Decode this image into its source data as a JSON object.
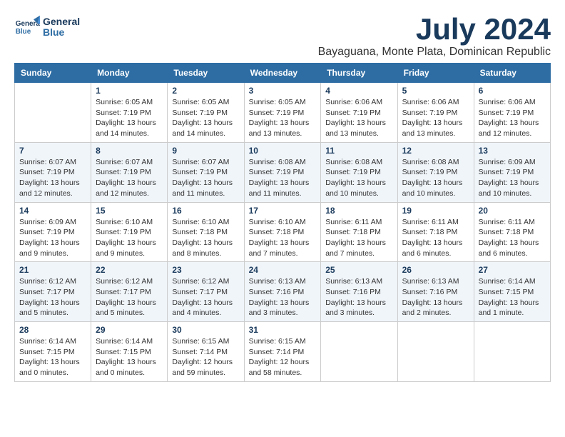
{
  "header": {
    "logo_line1": "General",
    "logo_line2": "Blue",
    "month_title": "July 2024",
    "location": "Bayaguana, Monte Plata, Dominican Republic"
  },
  "days_of_week": [
    "Sunday",
    "Monday",
    "Tuesday",
    "Wednesday",
    "Thursday",
    "Friday",
    "Saturday"
  ],
  "weeks": [
    [
      {
        "day": "",
        "info": ""
      },
      {
        "day": "1",
        "info": "Sunrise: 6:05 AM\nSunset: 7:19 PM\nDaylight: 13 hours\nand 14 minutes."
      },
      {
        "day": "2",
        "info": "Sunrise: 6:05 AM\nSunset: 7:19 PM\nDaylight: 13 hours\nand 14 minutes."
      },
      {
        "day": "3",
        "info": "Sunrise: 6:05 AM\nSunset: 7:19 PM\nDaylight: 13 hours\nand 13 minutes."
      },
      {
        "day": "4",
        "info": "Sunrise: 6:06 AM\nSunset: 7:19 PM\nDaylight: 13 hours\nand 13 minutes."
      },
      {
        "day": "5",
        "info": "Sunrise: 6:06 AM\nSunset: 7:19 PM\nDaylight: 13 hours\nand 13 minutes."
      },
      {
        "day": "6",
        "info": "Sunrise: 6:06 AM\nSunset: 7:19 PM\nDaylight: 13 hours\nand 12 minutes."
      }
    ],
    [
      {
        "day": "7",
        "info": "Sunrise: 6:07 AM\nSunset: 7:19 PM\nDaylight: 13 hours\nand 12 minutes."
      },
      {
        "day": "8",
        "info": "Sunrise: 6:07 AM\nSunset: 7:19 PM\nDaylight: 13 hours\nand 12 minutes."
      },
      {
        "day": "9",
        "info": "Sunrise: 6:07 AM\nSunset: 7:19 PM\nDaylight: 13 hours\nand 11 minutes."
      },
      {
        "day": "10",
        "info": "Sunrise: 6:08 AM\nSunset: 7:19 PM\nDaylight: 13 hours\nand 11 minutes."
      },
      {
        "day": "11",
        "info": "Sunrise: 6:08 AM\nSunset: 7:19 PM\nDaylight: 13 hours\nand 10 minutes."
      },
      {
        "day": "12",
        "info": "Sunrise: 6:08 AM\nSunset: 7:19 PM\nDaylight: 13 hours\nand 10 minutes."
      },
      {
        "day": "13",
        "info": "Sunrise: 6:09 AM\nSunset: 7:19 PM\nDaylight: 13 hours\nand 10 minutes."
      }
    ],
    [
      {
        "day": "14",
        "info": "Sunrise: 6:09 AM\nSunset: 7:19 PM\nDaylight: 13 hours\nand 9 minutes."
      },
      {
        "day": "15",
        "info": "Sunrise: 6:10 AM\nSunset: 7:19 PM\nDaylight: 13 hours\nand 9 minutes."
      },
      {
        "day": "16",
        "info": "Sunrise: 6:10 AM\nSunset: 7:18 PM\nDaylight: 13 hours\nand 8 minutes."
      },
      {
        "day": "17",
        "info": "Sunrise: 6:10 AM\nSunset: 7:18 PM\nDaylight: 13 hours\nand 7 minutes."
      },
      {
        "day": "18",
        "info": "Sunrise: 6:11 AM\nSunset: 7:18 PM\nDaylight: 13 hours\nand 7 minutes."
      },
      {
        "day": "19",
        "info": "Sunrise: 6:11 AM\nSunset: 7:18 PM\nDaylight: 13 hours\nand 6 minutes."
      },
      {
        "day": "20",
        "info": "Sunrise: 6:11 AM\nSunset: 7:18 PM\nDaylight: 13 hours\nand 6 minutes."
      }
    ],
    [
      {
        "day": "21",
        "info": "Sunrise: 6:12 AM\nSunset: 7:17 PM\nDaylight: 13 hours\nand 5 minutes."
      },
      {
        "day": "22",
        "info": "Sunrise: 6:12 AM\nSunset: 7:17 PM\nDaylight: 13 hours\nand 5 minutes."
      },
      {
        "day": "23",
        "info": "Sunrise: 6:12 AM\nSunset: 7:17 PM\nDaylight: 13 hours\nand 4 minutes."
      },
      {
        "day": "24",
        "info": "Sunrise: 6:13 AM\nSunset: 7:16 PM\nDaylight: 13 hours\nand 3 minutes."
      },
      {
        "day": "25",
        "info": "Sunrise: 6:13 AM\nSunset: 7:16 PM\nDaylight: 13 hours\nand 3 minutes."
      },
      {
        "day": "26",
        "info": "Sunrise: 6:13 AM\nSunset: 7:16 PM\nDaylight: 13 hours\nand 2 minutes."
      },
      {
        "day": "27",
        "info": "Sunrise: 6:14 AM\nSunset: 7:15 PM\nDaylight: 13 hours\nand 1 minute."
      }
    ],
    [
      {
        "day": "28",
        "info": "Sunrise: 6:14 AM\nSunset: 7:15 PM\nDaylight: 13 hours\nand 0 minutes."
      },
      {
        "day": "29",
        "info": "Sunrise: 6:14 AM\nSunset: 7:15 PM\nDaylight: 13 hours\nand 0 minutes."
      },
      {
        "day": "30",
        "info": "Sunrise: 6:15 AM\nSunset: 7:14 PM\nDaylight: 12 hours\nand 59 minutes."
      },
      {
        "day": "31",
        "info": "Sunrise: 6:15 AM\nSunset: 7:14 PM\nDaylight: 12 hours\nand 58 minutes."
      },
      {
        "day": "",
        "info": ""
      },
      {
        "day": "",
        "info": ""
      },
      {
        "day": "",
        "info": ""
      }
    ]
  ]
}
